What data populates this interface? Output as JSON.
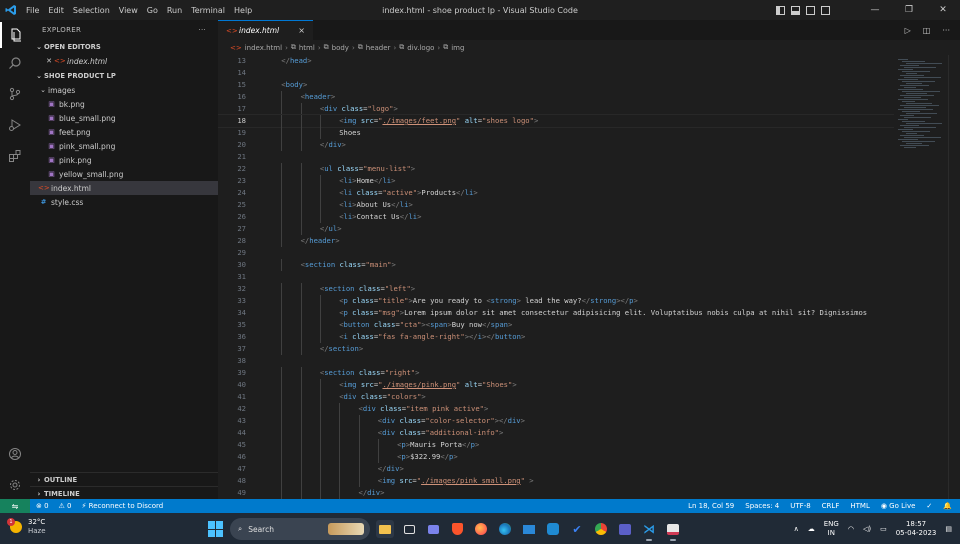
{
  "titlebar": {
    "menu": [
      "File",
      "Edit",
      "Selection",
      "View",
      "Go",
      "Run",
      "Terminal",
      "Help"
    ],
    "title": "index.html - shoe product lp - Visual Studio Code",
    "controls": [
      "—",
      "❐",
      "✕"
    ]
  },
  "sidebar": {
    "header": "EXPLORER",
    "more": "···",
    "open_editors_label": "OPEN EDITORS",
    "open_editor_file": "index.html",
    "open_editor_close": "✕",
    "project_label": "SHOE PRODUCT LP",
    "folder": "images",
    "images": [
      "bk.png",
      "blue_small.png",
      "feet.png",
      "pink_small.png",
      "pink.png",
      "yellow_small.png"
    ],
    "root_files": [
      "index.html",
      "style.css"
    ],
    "outline_label": "OUTLINE",
    "timeline_label": "TIMELINE"
  },
  "editor": {
    "tab_label": "index.html",
    "tab_close": "×",
    "breadcrumbs": [
      "index.html",
      "html",
      "body",
      "header",
      "div.logo",
      "img"
    ],
    "current_line": 18,
    "lines": [
      {
        "n": 13,
        "indent": 1,
        "html": "<span class='t-punct'>&lt;/</span><span class='t-tag'>head</span><span class='t-punct'>&gt;</span>"
      },
      {
        "n": 14,
        "indent": 0,
        "html": ""
      },
      {
        "n": 15,
        "indent": 1,
        "html": "<span class='t-punct'>&lt;</span><span class='t-tag'>body</span><span class='t-punct'>&gt;</span>"
      },
      {
        "n": 16,
        "indent": 2,
        "html": "<span class='t-punct'>&lt;</span><span class='t-tag'>header</span><span class='t-punct'>&gt;</span>"
      },
      {
        "n": 17,
        "indent": 3,
        "html": "<span class='t-punct'>&lt;</span><span class='t-tag'>div</span> <span class='t-attr'>class</span>=<span class='t-str'>\"logo\"</span><span class='t-punct'>&gt;</span>"
      },
      {
        "n": 18,
        "indent": 4,
        "html": "<span class='t-punct'>&lt;</span><span class='t-tag'>img</span> <span class='t-attr'>src</span>=<span class='t-str'>\"<span class='u'>./images/feet.png</span>\"</span> <span class='t-attr'>alt</span>=<span class='t-str'>\"shoes logo\"</span><span class='t-punct'>&gt;</span>"
      },
      {
        "n": 19,
        "indent": 4,
        "html": "<span class='t-text'>Shoes</span>"
      },
      {
        "n": 20,
        "indent": 3,
        "html": "<span class='t-punct'>&lt;/</span><span class='t-tag'>div</span><span class='t-punct'>&gt;</span>"
      },
      {
        "n": 21,
        "indent": 0,
        "html": ""
      },
      {
        "n": 22,
        "indent": 3,
        "html": "<span class='t-punct'>&lt;</span><span class='t-tag'>ul</span> <span class='t-attr'>class</span>=<span class='t-str'>\"menu-list\"</span><span class='t-punct'>&gt;</span>"
      },
      {
        "n": 23,
        "indent": 4,
        "html": "<span class='t-punct'>&lt;</span><span class='t-tag'>li</span><span class='t-punct'>&gt;</span><span class='t-text'>Home</span><span class='t-punct'>&lt;/</span><span class='t-tag'>li</span><span class='t-punct'>&gt;</span>"
      },
      {
        "n": 24,
        "indent": 4,
        "html": "<span class='t-punct'>&lt;</span><span class='t-tag'>li</span> <span class='t-attr'>class</span>=<span class='t-str'>\"active\"</span><span class='t-punct'>&gt;</span><span class='t-text'>Products</span><span class='t-punct'>&lt;/</span><span class='t-tag'>li</span><span class='t-punct'>&gt;</span>"
      },
      {
        "n": 25,
        "indent": 4,
        "html": "<span class='t-punct'>&lt;</span><span class='t-tag'>li</span><span class='t-punct'>&gt;</span><span class='t-text'>About Us</span><span class='t-punct'>&lt;/</span><span class='t-tag'>li</span><span class='t-punct'>&gt;</span>"
      },
      {
        "n": 26,
        "indent": 4,
        "html": "<span class='t-punct'>&lt;</span><span class='t-tag'>li</span><span class='t-punct'>&gt;</span><span class='t-text'>Contact Us</span><span class='t-punct'>&lt;/</span><span class='t-tag'>li</span><span class='t-punct'>&gt;</span>"
      },
      {
        "n": 27,
        "indent": 3,
        "html": "<span class='t-punct'>&lt;/</span><span class='t-tag'>ul</span><span class='t-punct'>&gt;</span>"
      },
      {
        "n": 28,
        "indent": 2,
        "html": "<span class='t-punct'>&lt;/</span><span class='t-tag'>header</span><span class='t-punct'>&gt;</span>"
      },
      {
        "n": 29,
        "indent": 0,
        "html": ""
      },
      {
        "n": 30,
        "indent": 2,
        "html": "<span class='t-punct'>&lt;</span><span class='t-tag'>section</span> <span class='t-attr'>class</span>=<span class='t-str'>\"main\"</span><span class='t-punct'>&gt;</span>"
      },
      {
        "n": 31,
        "indent": 0,
        "html": ""
      },
      {
        "n": 32,
        "indent": 3,
        "html": "<span class='t-punct'>&lt;</span><span class='t-tag'>section</span> <span class='t-attr'>class</span>=<span class='t-str'>\"left\"</span><span class='t-punct'>&gt;</span>"
      },
      {
        "n": 33,
        "indent": 4,
        "html": "<span class='t-punct'>&lt;</span><span class='t-tag'>p</span> <span class='t-attr'>class</span>=<span class='t-str'>\"title\"</span><span class='t-punct'>&gt;</span><span class='t-text'>Are you ready to </span><span class='t-punct'>&lt;</span><span class='t-tag'>strong</span><span class='t-punct'>&gt;</span><span class='t-text'> lead the way?</span><span class='t-punct'>&lt;/</span><span class='t-tag'>strong</span><span class='t-punct'>&gt;&lt;/</span><span class='t-tag'>p</span><span class='t-punct'>&gt;</span>"
      },
      {
        "n": 34,
        "indent": 4,
        "html": "<span class='t-punct'>&lt;</span><span class='t-tag'>p</span> <span class='t-attr'>class</span>=<span class='t-str'>\"msg\"</span><span class='t-punct'>&gt;</span><span class='t-text'>Lorem ipsum dolor sit amet consectetur adipisicing elit. Voluptatibus nobis culpa at nihil sit? Dignissimos</span>"
      },
      {
        "n": 35,
        "indent": 4,
        "html": "<span class='t-punct'>&lt;</span><span class='t-tag'>button</span> <span class='t-attr'>class</span>=<span class='t-str'>\"cta\"</span><span class='t-punct'>&gt;&lt;</span><span class='t-tag'>span</span><span class='t-punct'>&gt;</span><span class='t-text'>Buy now</span><span class='t-punct'>&lt;/</span><span class='t-tag'>span</span><span class='t-punct'>&gt;</span>"
      },
      {
        "n": 36,
        "indent": 4,
        "html": "<span class='t-punct'>&lt;</span><span class='t-tag'>i</span> <span class='t-attr'>class</span>=<span class='t-str'>\"fas fa-angle-right\"</span><span class='t-punct'>&gt;&lt;/</span><span class='t-tag'>i</span><span class='t-punct'>&gt;&lt;/</span><span class='t-tag'>button</span><span class='t-punct'>&gt;</span>"
      },
      {
        "n": 37,
        "indent": 3,
        "html": "<span class='t-punct'>&lt;/</span><span class='t-tag'>section</span><span class='t-punct'>&gt;</span>"
      },
      {
        "n": 38,
        "indent": 0,
        "html": ""
      },
      {
        "n": 39,
        "indent": 3,
        "html": "<span class='t-punct'>&lt;</span><span class='t-tag'>section</span> <span class='t-attr'>class</span>=<span class='t-str'>\"right\"</span><span class='t-punct'>&gt;</span>"
      },
      {
        "n": 40,
        "indent": 4,
        "html": "<span class='t-punct'>&lt;</span><span class='t-tag'>img</span> <span class='t-attr'>src</span>=<span class='t-str'>\"<span class='u'>./images/pink.png</span>\"</span> <span class='t-attr'>alt</span>=<span class='t-str'>\"Shoes\"</span><span class='t-punct'>&gt;</span>"
      },
      {
        "n": 41,
        "indent": 4,
        "html": "<span class='t-punct'>&lt;</span><span class='t-tag'>div</span> <span class='t-attr'>class</span>=<span class='t-str'>\"colors\"</span><span class='t-punct'>&gt;</span>"
      },
      {
        "n": 42,
        "indent": 5,
        "html": "<span class='t-punct'>&lt;</span><span class='t-tag'>div</span> <span class='t-attr'>class</span>=<span class='t-str'>\"item pink active\"</span><span class='t-punct'>&gt;</span>"
      },
      {
        "n": 43,
        "indent": 6,
        "html": "<span class='t-punct'>&lt;</span><span class='t-tag'>div</span> <span class='t-attr'>class</span>=<span class='t-str'>\"color-selector\"</span><span class='t-punct'>&gt;&lt;/</span><span class='t-tag'>div</span><span class='t-punct'>&gt;</span>"
      },
      {
        "n": 44,
        "indent": 6,
        "html": "<span class='t-punct'>&lt;</span><span class='t-tag'>div</span> <span class='t-attr'>class</span>=<span class='t-str'>\"additional-info\"</span><span class='t-punct'>&gt;</span>"
      },
      {
        "n": 45,
        "indent": 7,
        "html": "<span class='t-punct'>&lt;</span><span class='t-tag'>p</span><span class='t-punct'>&gt;</span><span class='t-text'>Mauris Porta</span><span class='t-punct'>&lt;/</span><span class='t-tag'>p</span><span class='t-punct'>&gt;</span>"
      },
      {
        "n": 46,
        "indent": 7,
        "html": "<span class='t-punct'>&lt;</span><span class='t-tag'>p</span><span class='t-punct'>&gt;</span><span class='t-text'>$322.99</span><span class='t-punct'>&lt;/</span><span class='t-tag'>p</span><span class='t-punct'>&gt;</span>"
      },
      {
        "n": 47,
        "indent": 6,
        "html": "<span class='t-punct'>&lt;/</span><span class='t-tag'>div</span><span class='t-punct'>&gt;</span>"
      },
      {
        "n": 48,
        "indent": 6,
        "html": "<span class='t-punct'>&lt;</span><span class='t-tag'>img</span> <span class='t-attr'>src</span>=<span class='t-str'>\"<span class='u'>./images/pink_small.png</span>\"</span> <span class='t-punct'>&gt;</span>"
      },
      {
        "n": 49,
        "indent": 5,
        "html": "<span class='t-punct'>&lt;/</span><span class='t-tag'>div</span><span class='t-punct'>&gt;</span>"
      }
    ]
  },
  "statusbar": {
    "remote_icon": "⇋",
    "errors": "⊗ 0",
    "warnings": "⚠ 0",
    "remote": "⚡ Reconnect to Discord",
    "position": "Ln 18, Col 59",
    "spaces": "Spaces: 4",
    "encoding": "UTF-8",
    "eol": "CRLF",
    "language": "HTML",
    "go_live": "◉ Go Live",
    "feedback": "✓",
    "bell": "🔔"
  },
  "taskbar": {
    "temperature": "32°C",
    "condition": "Haze",
    "badge": "1",
    "search_placeholder": "Search",
    "language_1": "ENG",
    "language_2": "IN",
    "time": "18:57",
    "date": "05-04-2023",
    "tray_chevron": "∧"
  },
  "colors": {
    "accent": "#007acc",
    "tab_border": "#0078d4",
    "remote": "#16825d"
  }
}
